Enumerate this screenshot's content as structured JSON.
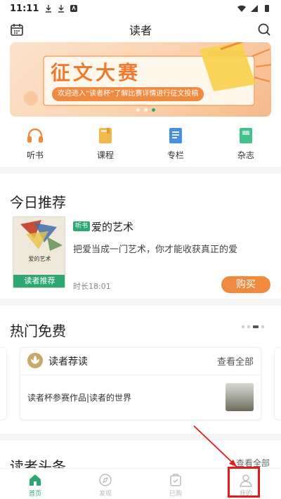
{
  "status_bar": {
    "time": "11:11"
  },
  "header": {
    "title": "读者"
  },
  "banner": {
    "title": "征文大赛",
    "subtitle": "欢迎进入“读者杯”了解比赛详情进行征文投稿"
  },
  "quick_nav": [
    {
      "label": "听书",
      "icon": "headphones-icon",
      "color": "#f08a3e"
    },
    {
      "label": "课程",
      "icon": "book-icon",
      "color": "#f2b84b"
    },
    {
      "label": "专栏",
      "icon": "column-icon",
      "color": "#4a90e2"
    },
    {
      "label": "杂志",
      "icon": "magazine-icon",
      "color": "#43c08b"
    }
  ],
  "today": {
    "section_title": "今日推荐",
    "tag": "听书",
    "book_title": "爱的艺术",
    "cover_title": "爱的艺术",
    "cover_badge": "读者推荐",
    "description": "把爱当成一门艺术，你才能收获真正的爱",
    "duration": "时长18:01",
    "buy_label": "购买"
  },
  "hot_free": {
    "section_title": "热门免费",
    "card_title": "读者荐读",
    "view_all": "查看全部",
    "item_title": "读者杯参赛作品|读者的世界"
  },
  "headlines": {
    "section_title": "读者头条",
    "view_all": "查看全部"
  },
  "bottom_nav": [
    {
      "label": "首页",
      "icon": "home-icon",
      "active": true
    },
    {
      "label": "发现",
      "icon": "compass-icon",
      "active": false
    },
    {
      "label": "已购",
      "icon": "purchased-icon",
      "active": false
    },
    {
      "label": "我的",
      "icon": "profile-icon",
      "active": false
    }
  ],
  "colors": {
    "accent_green": "#2ea873",
    "accent_orange": "#f08a3e",
    "annotation_red": "#e21b1b"
  }
}
